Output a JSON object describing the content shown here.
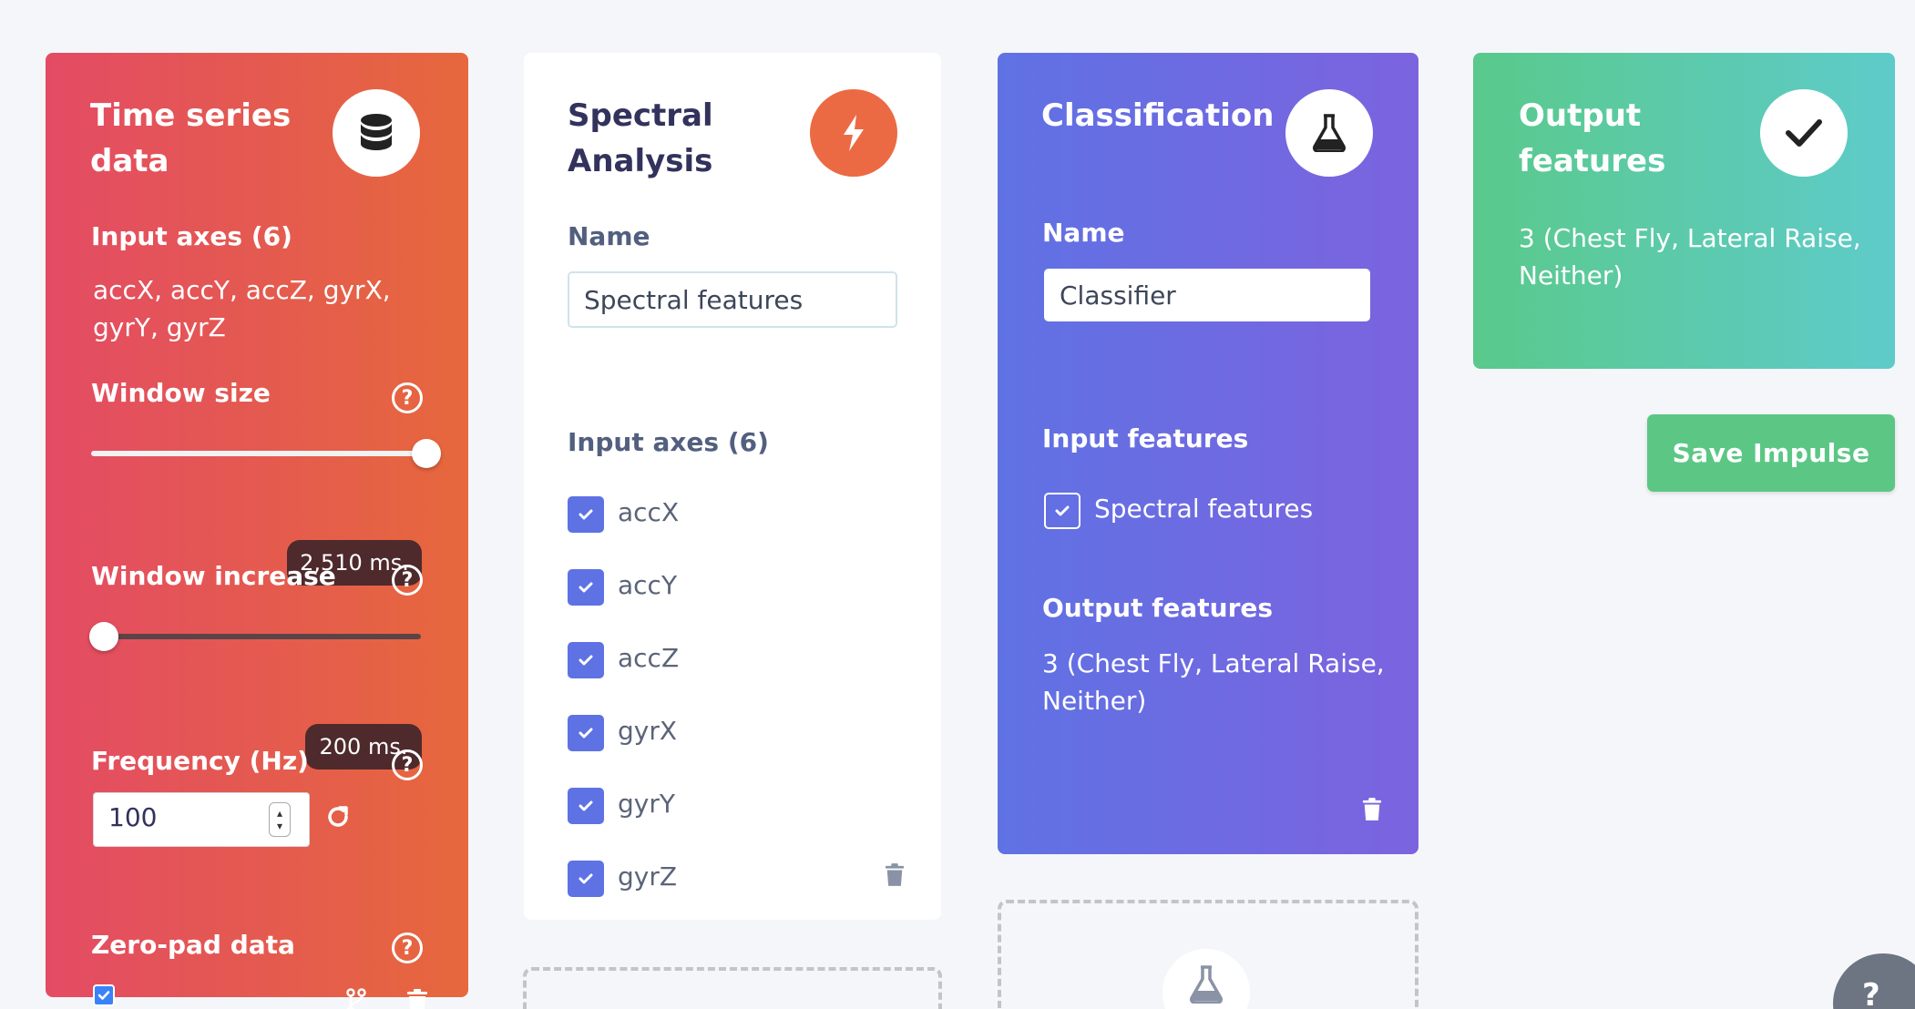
{
  "time_series": {
    "title": "Time series data",
    "icon": "database-icon",
    "input_axes_label": "Input axes (6)",
    "input_axes_value": "accX, accY, accZ, gyrX, gyrY, gyrZ",
    "window_size_label": "Window size",
    "window_size_value": "2,510 ms.",
    "window_size_level": 1.0,
    "window_increase_label": "Window increase",
    "window_increase_value": "200 ms.",
    "window_increase_level": 0.0,
    "frequency_label": "Frequency (Hz)",
    "frequency_value": "100",
    "zero_pad_label": "Zero-pad data",
    "zero_pad_checked": true,
    "help_glyph": "?"
  },
  "spectral": {
    "title": "Spectral Analysis",
    "icon": "lightning-icon",
    "name_label": "Name",
    "name_value": "Spectral features",
    "input_axes_label": "Input axes (6)",
    "axes": [
      "accX",
      "accY",
      "accZ",
      "gyrX",
      "gyrY",
      "gyrZ"
    ]
  },
  "classification": {
    "title": "Classification",
    "icon": "flask-icon",
    "name_label": "Name",
    "name_value": "Classifier",
    "input_features_label": "Input features",
    "input_feature": "Spectral features",
    "output_features_label": "Output features",
    "output_features_value": "3 (Chest Fly, Lateral Raise, Neither)"
  },
  "output": {
    "title": "Output features",
    "icon": "check-icon",
    "value": "3 (Chest Fly, Lateral Raise, Neither)"
  },
  "save_button": "Save Impulse",
  "help_fab_glyph": "?",
  "colors": {
    "time_series_gradient": [
      "#e34b64",
      "#e6683c"
    ],
    "spectral_accent": "#ec6a43",
    "classification_gradient": [
      "#5f72e4",
      "#7c63df"
    ],
    "output_gradient": [
      "#5ac98b",
      "#5ecbca"
    ],
    "save_button": "#5cc785",
    "checkbox": "#5e72e4"
  }
}
